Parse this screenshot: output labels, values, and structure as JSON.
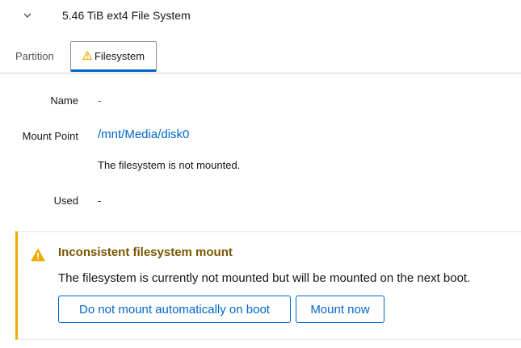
{
  "header": {
    "title": "5.46 TiB ext4 File System"
  },
  "tabs": [
    {
      "label": "Partition"
    },
    {
      "label": "Filesystem"
    }
  ],
  "details": {
    "name_label": "Name",
    "name_value": "-",
    "mount_label": "Mount Point",
    "mount_value": "/mnt/Media/disk0",
    "mount_note": "The filesystem is not mounted.",
    "used_label": "Used",
    "used_value": "-"
  },
  "alert": {
    "title": "Inconsistent filesystem mount",
    "body": "The filesystem is currently not mounted but will be mounted on the next boot.",
    "btn_no_mount": "Do not mount automatically on boot",
    "btn_mount_now": "Mount now"
  },
  "colors": {
    "link": "#0066cc",
    "warning": "#f0ab00",
    "warning_title": "#795600"
  },
  "icons": {
    "chevron": "chevron-down-icon",
    "tab_warning": "warning-triangle-icon",
    "alert_warning": "warning-triangle-icon"
  }
}
